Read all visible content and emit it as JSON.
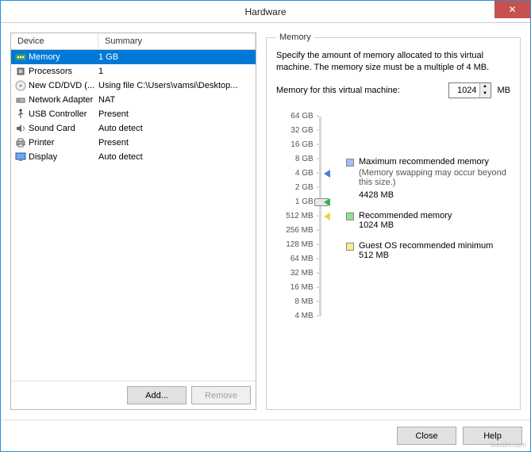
{
  "window": {
    "title": "Hardware"
  },
  "columns": {
    "device": "Device",
    "summary": "Summary"
  },
  "devices": [
    {
      "name": "Memory",
      "summary": "1 GB",
      "icon": "memory-icon"
    },
    {
      "name": "Processors",
      "summary": "1",
      "icon": "cpu-icon"
    },
    {
      "name": "New CD/DVD (...",
      "summary": "Using file C:\\Users\\vamsi\\Desktop...",
      "icon": "disc-icon"
    },
    {
      "name": "Network Adapter",
      "summary": "NAT",
      "icon": "network-icon"
    },
    {
      "name": "USB Controller",
      "summary": "Present",
      "icon": "usb-icon"
    },
    {
      "name": "Sound Card",
      "summary": "Auto detect",
      "icon": "sound-icon"
    },
    {
      "name": "Printer",
      "summary": "Present",
      "icon": "printer-icon"
    },
    {
      "name": "Display",
      "summary": "Auto detect",
      "icon": "display-icon"
    }
  ],
  "selected_index": 0,
  "buttons": {
    "add": "Add...",
    "remove": "Remove",
    "close": "Close",
    "help": "Help"
  },
  "memory": {
    "group_title": "Memory",
    "description": "Specify the amount of memory allocated to this virtual machine. The memory size must be a multiple of 4 MB.",
    "input_label": "Memory for this virtual machine:",
    "value": "1024",
    "unit": "MB",
    "slider_labels": [
      "64 GB",
      "32 GB",
      "16 GB",
      "8 GB",
      "4 GB",
      "2 GB",
      "1 GB",
      "512 MB",
      "256 MB",
      "128 MB",
      "64 MB",
      "32 MB",
      "16 MB",
      "8 MB",
      "4 MB"
    ],
    "markers": {
      "max_index": 4,
      "current_index": 6,
      "rec_index": 6,
      "min_index": 7
    },
    "legends": {
      "max": {
        "title": "Maximum recommended memory",
        "note": "(Memory swapping may occur beyond this size.)",
        "value": "4428 MB"
      },
      "rec": {
        "title": "Recommended memory",
        "value": "1024 MB"
      },
      "min": {
        "title": "Guest OS recommended minimum",
        "value": "512 MB"
      }
    }
  },
  "watermark": "wsxdn.com"
}
